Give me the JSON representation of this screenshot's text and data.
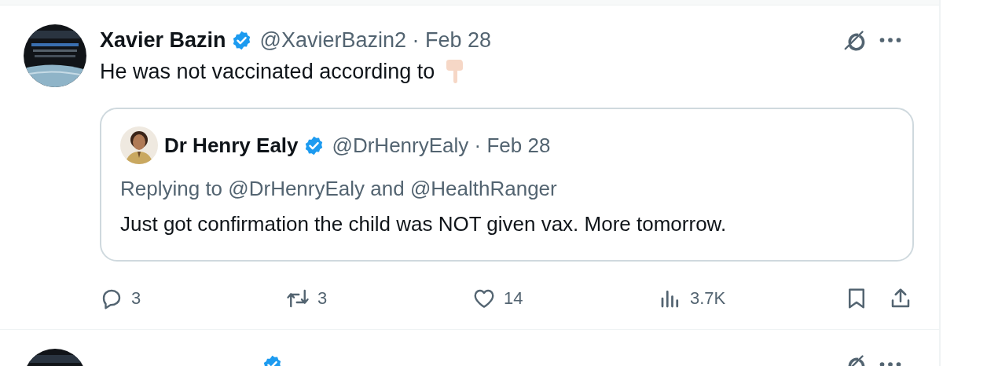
{
  "tweets": [
    {
      "author": {
        "name": "Xavier Bazin",
        "verified": true,
        "meta": "@XavierBazin2 · Feb 28"
      },
      "text": "He was not vaccinated according to",
      "quote": {
        "author": {
          "name": "Dr Henry Ealy",
          "verified": true,
          "meta": "@DrHenryEaly · Feb 28"
        },
        "replying_to": "Replying to @DrHenryEaly and @HealthRanger",
        "text": "Just got confirmation the child was NOT given vax. More tomorrow."
      },
      "actions": [
        {
          "kind": "reply",
          "count": "3"
        },
        {
          "kind": "repost",
          "count": "3"
        },
        {
          "kind": "like",
          "count": "14"
        },
        {
          "kind": "views",
          "count": "3.7K"
        },
        {
          "kind": "bookmark"
        },
        {
          "kind": "share"
        }
      ]
    },
    {
      "author": {
        "verified": true
      }
    }
  ]
}
